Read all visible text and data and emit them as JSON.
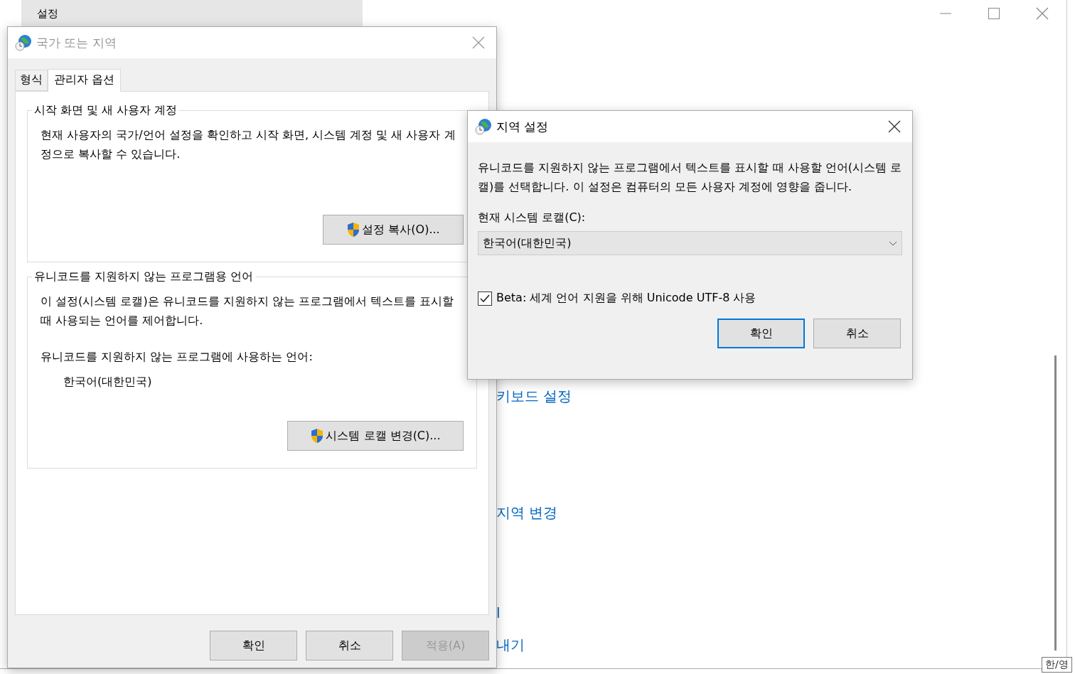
{
  "settings_window": {
    "title": "설정",
    "links": [
      "키보드 설정",
      "지역 변경",
      "l",
      "내기"
    ],
    "ime_indicator": "한/영"
  },
  "region_dialog": {
    "title": "국가 또는 지역",
    "tabs": [
      {
        "label": "형식",
        "selected": false
      },
      {
        "label": "관리자 옵션",
        "selected": true
      }
    ],
    "groups": [
      {
        "title": "시작 화면 및 새 사용자 계정",
        "description": "현재 사용자의 국가/언어 설정을 확인하고 시작 화면, 시스템 계정 및 새 사용자 계정으로 복사할 수 있습니다.",
        "button": "설정 복사(O)..."
      },
      {
        "title": "유니코드를 지원하지 않는 프로그램용 언어",
        "description": "이 설정(시스템 로캘)은 유니코드를 지원하지 않는 프로그램에서 텍스트를 표시할 때 사용되는 언어를 제어합니다.",
        "current_label": "유니코드를 지원하지 않는 프로그램에 사용하는 언어:",
        "current_value": "한국어(대한민국)",
        "button": "시스템 로캘 변경(C)..."
      }
    ],
    "buttons": [
      {
        "label": "확인",
        "disabled": false
      },
      {
        "label": "취소",
        "disabled": false
      },
      {
        "label": "적용(A)",
        "disabled": true
      }
    ]
  },
  "locale_dialog": {
    "title": "지역 설정",
    "description": "유니코드를 지원하지 않는 프로그램에서 텍스트를 표시할 때 사용할 언어(시스템 로캘)를 선택합니다. 이 설정은 컴퓨터의 모든 사용자 계정에 영향을 줍니다.",
    "locale_label": "현재 시스템 로캘(C):",
    "locale_value": "한국어(대한민국)",
    "beta_option": {
      "label": "Beta: 세계 언어 지원을 위해 Unicode UTF-8 사용",
      "checked": true
    },
    "buttons": [
      {
        "label": "확인",
        "default": true
      },
      {
        "label": "취소",
        "default": false
      }
    ]
  }
}
